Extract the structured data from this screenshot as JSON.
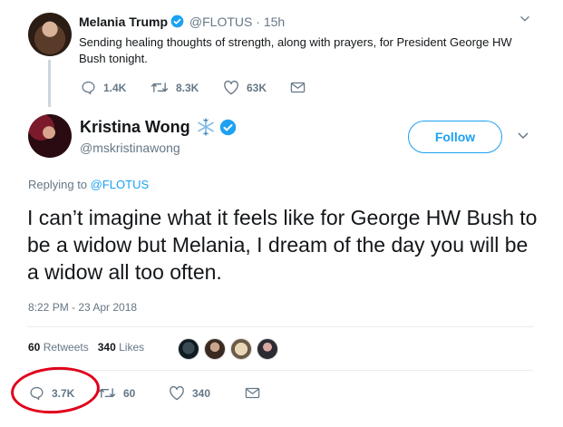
{
  "quoted_tweet": {
    "name": "Melania Trump",
    "handle": "@FLOTUS",
    "separator": "·",
    "time": "15h",
    "text": "Sending healing thoughts of strength, along with prayers, for President George HW Bush tonight.",
    "actions": {
      "replies": "1.4K",
      "retweets": "8.3K",
      "likes": "63K"
    }
  },
  "main_tweet": {
    "name": "Kristina Wong",
    "handle": "@mskristinawong",
    "follow_label": "Follow",
    "replying_prefix": "Replying to",
    "replying_to": "@FLOTUS",
    "text": "I can’t imagine what it feels like for George HW Bush to be a widow but Melania, I dream of the day you will be a widow all too often.",
    "timestamp": "8:22 PM - 23 Apr 2018",
    "stats": {
      "retweets_count": "60",
      "retweets_label": "Retweets",
      "likes_count": "340",
      "likes_label": "Likes"
    },
    "actions": {
      "replies": "3.7K",
      "retweets": "60",
      "likes": "340"
    }
  },
  "colors": {
    "accent": "#1da1f2",
    "muted": "#657786",
    "text": "#14171a",
    "annotation": "#e0001b"
  },
  "icons": [
    "verified-badge-icon",
    "snowflake-icon",
    "chevron-down-icon",
    "reply-icon",
    "retweet-icon",
    "like-icon",
    "direct-message-icon"
  ]
}
